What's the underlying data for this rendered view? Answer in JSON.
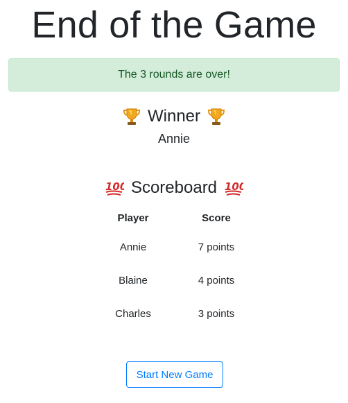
{
  "page": {
    "title": "End of the Game"
  },
  "alert": {
    "message": "The 3 rounds are over!",
    "color": "#155724",
    "background": "#d4edda"
  },
  "winner": {
    "heading": "Winner",
    "icon": "trophy-icon",
    "name": "Annie"
  },
  "scoreboard": {
    "heading": "Scoreboard",
    "icon": "hundred-points-icon",
    "columns": [
      "Player",
      "Score"
    ],
    "rows": [
      {
        "player": "Annie",
        "score": "7 points"
      },
      {
        "player": "Blaine",
        "score": "4 points"
      },
      {
        "player": "Charles",
        "score": "3 points"
      }
    ]
  },
  "actions": {
    "start_new_game_label": "Start New Game",
    "accent_color": "#007bff"
  }
}
